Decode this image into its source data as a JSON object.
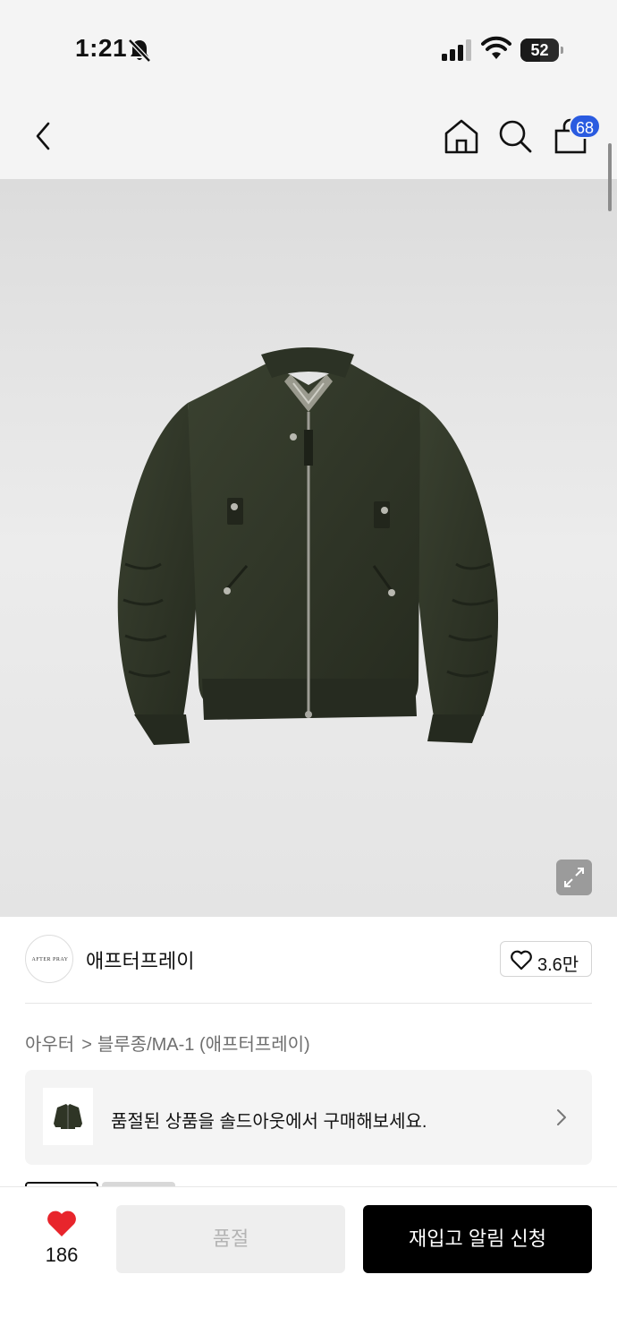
{
  "status_bar": {
    "time": "1:21",
    "battery": "52",
    "battery_level": 0.52,
    "icons": [
      "bell-off-icon",
      "signal-icon",
      "wifi-icon",
      "battery-icon"
    ]
  },
  "nav": {
    "icons": [
      "back-arrow-icon",
      "home-icon",
      "search-icon",
      "cart-icon"
    ],
    "cart_count": "68"
  },
  "product": {
    "image_alt_icon": "jacket-image",
    "zoom_icon": "expand-icon"
  },
  "brand": {
    "logo_text": "AFTER PRAY",
    "name": "애프터프레이",
    "likes": "3.6만",
    "like_icon": "heart-outline-icon"
  },
  "breadcrumb": {
    "category": "아우터",
    "separator": ">",
    "subcategory": "블루종/MA-1 (애프터프레이)"
  },
  "soldout_banner": {
    "text": "품절된 상품을 솔드아웃에서 구매해보세요.",
    "chevron_icon": "chevron-right-icon"
  },
  "bottom_bar": {
    "wish_count": "186",
    "wish_icon": "heart-filled-icon",
    "wish_color": "#e8252c",
    "soldout_label": "품절",
    "restock_label": "재입고 알림 신청"
  },
  "colors": {
    "badge": "#2a5be0",
    "jacket": "#2f3526",
    "primary_button": "#000000"
  }
}
